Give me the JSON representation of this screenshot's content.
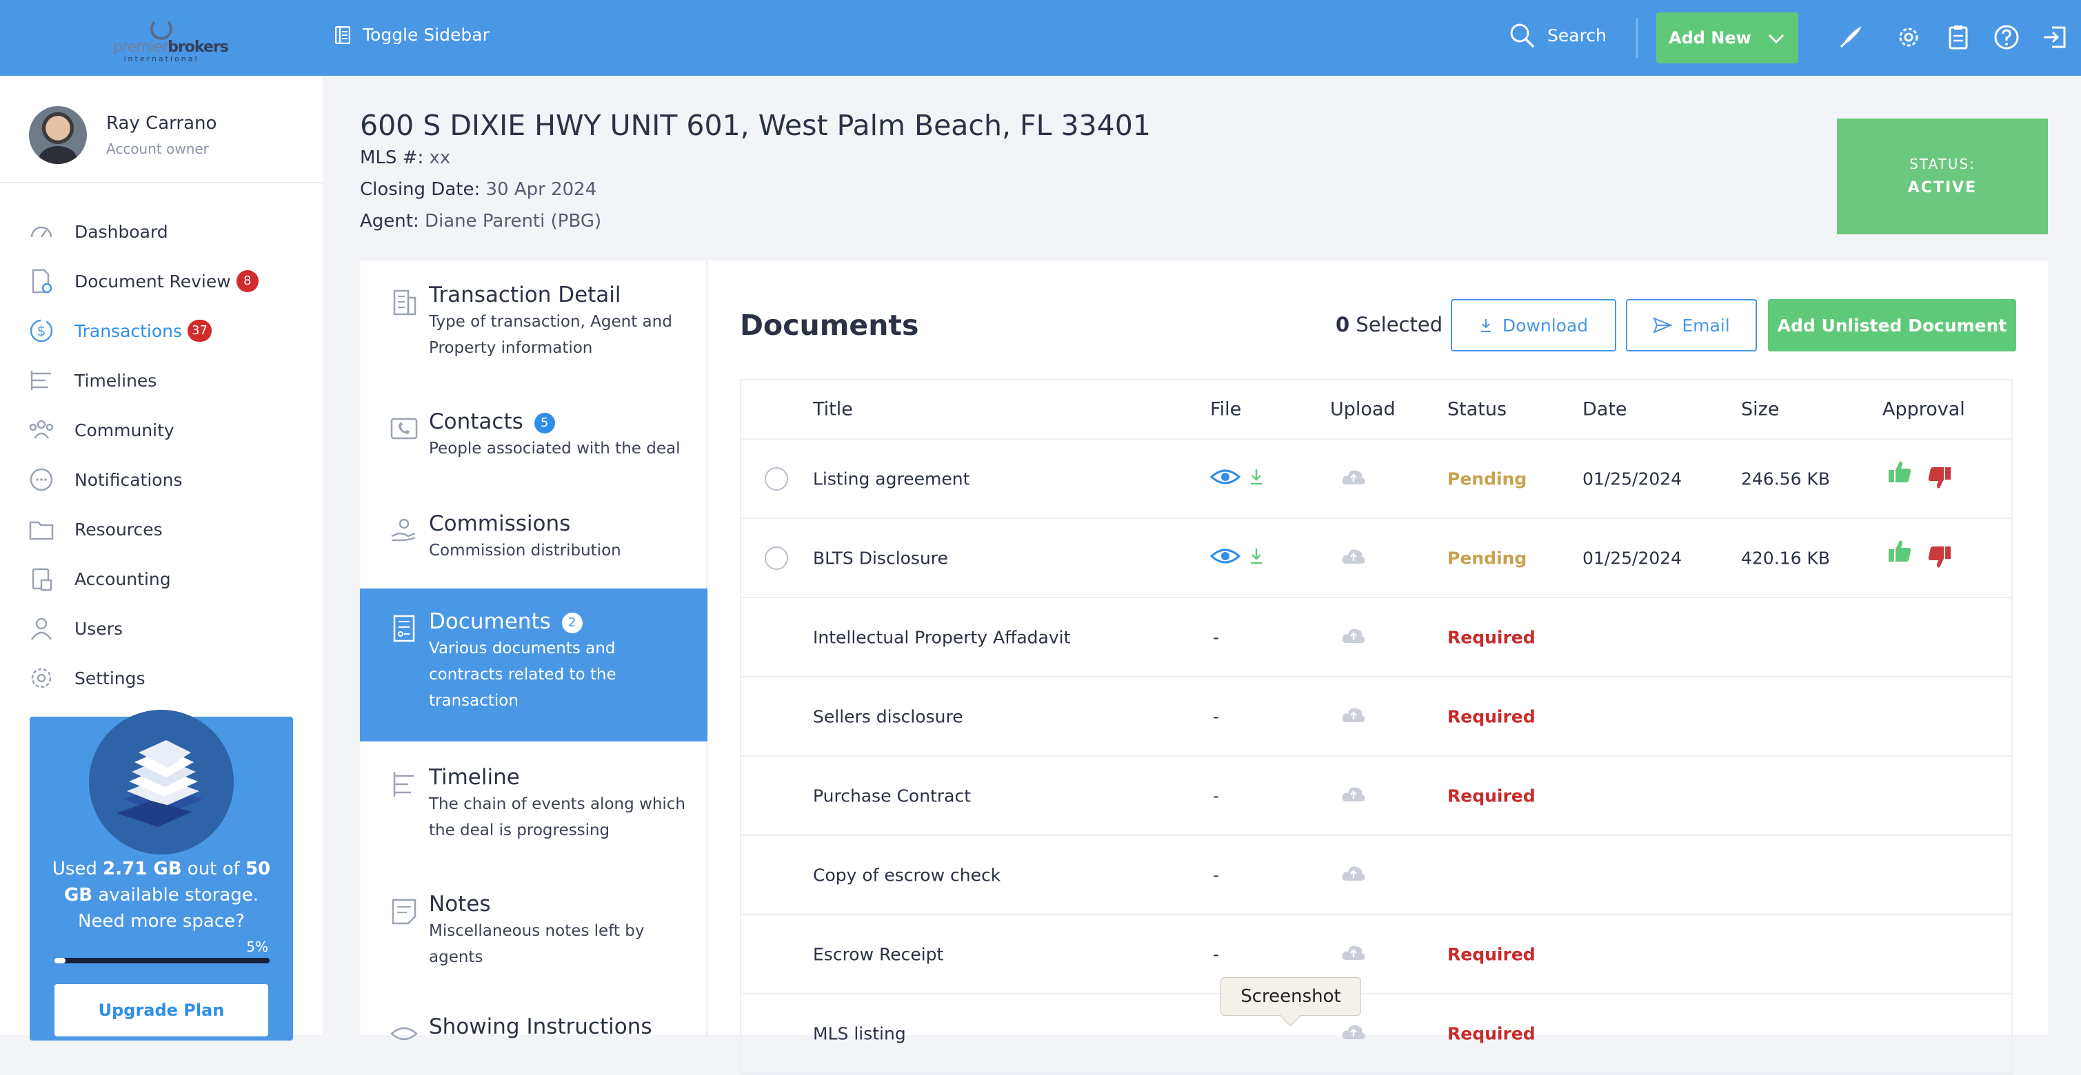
{
  "topbar": {
    "logo_word_a": "premier",
    "logo_word_b": "brokers",
    "logo_sub": "international",
    "toggle_label": "Toggle Sidebar",
    "search_label": "Search",
    "add_new_label": "Add New",
    "icons": [
      "rocket-icon",
      "gear-icon",
      "clipboard-icon",
      "help-icon",
      "logout-icon"
    ],
    "accent": "#4a97e6"
  },
  "user": {
    "name": "Ray Carrano",
    "role": "Account owner"
  },
  "sidebar": {
    "items": [
      {
        "label": "Dashboard",
        "icon": "dashboard-icon",
        "badge": ""
      },
      {
        "label": "Document Review",
        "icon": "document-review-icon",
        "badge": "8"
      },
      {
        "label": "Transactions",
        "icon": "dollar-icon",
        "badge": "37",
        "active": true
      },
      {
        "label": "Timelines",
        "icon": "timeline-icon",
        "badge": ""
      },
      {
        "label": "Community",
        "icon": "community-icon",
        "badge": ""
      },
      {
        "label": "Notifications",
        "icon": "chat-icon",
        "badge": ""
      },
      {
        "label": "Resources",
        "icon": "folder-icon",
        "badge": ""
      },
      {
        "label": "Accounting",
        "icon": "accounting-icon",
        "badge": ""
      },
      {
        "label": "Users",
        "icon": "user-icon",
        "badge": ""
      },
      {
        "label": "Settings",
        "icon": "gear-icon",
        "badge": ""
      }
    ]
  },
  "storage": {
    "prefix": "Used ",
    "used": "2.71 GB",
    "mid": " out of ",
    "total": "50 GB",
    "suffix": " available storage. Need more space?",
    "percent_label": "5%",
    "percent": 0.05,
    "upgrade_label": "Upgrade Plan"
  },
  "property": {
    "title": "600 S DIXIE HWY UNIT 601, West Palm Beach, FL 33401",
    "mls_label": "MLS #:",
    "mls_value": "xx",
    "closing_label": "Closing Date:",
    "closing_value": "30 Apr 2024",
    "agent_label": "Agent:",
    "agent_value": "Diane Parenti (PBG)",
    "status_label": "STATUS:",
    "status_value": "ACTIVE",
    "status_color": "#6cc77f"
  },
  "steps": [
    {
      "title": "Transaction Detail",
      "desc": "Type of transaction, Agent and Property information",
      "count": "",
      "icon": "building-icon"
    },
    {
      "title": "Contacts",
      "desc": "People associated with the deal",
      "count": "5",
      "icon": "phone-icon"
    },
    {
      "title": "Commissions",
      "desc": "Commission distribution",
      "count": "",
      "icon": "hand-coin-icon"
    },
    {
      "title": "Documents",
      "desc": "Various documents and contracts related to the transaction",
      "count": "2",
      "icon": "document-icon",
      "active": true
    },
    {
      "title": "Timeline",
      "desc": "The chain of events along which the deal is progressing",
      "count": "",
      "icon": "timeline-icon"
    },
    {
      "title": "Notes",
      "desc": "Miscellaneous notes left by agents",
      "count": "",
      "icon": "note-icon"
    },
    {
      "title": "Showing Instructions",
      "desc": "",
      "count": "",
      "icon": "eye-icon"
    }
  ],
  "documents": {
    "heading": "Documents",
    "selected_count": "0",
    "selected_label": "Selected",
    "download_label": "Download",
    "email_label": "Email",
    "add_unlisted_label": "Add Unlisted Document",
    "columns": [
      "Title",
      "File",
      "Upload",
      "Status",
      "Date",
      "Size",
      "Approval"
    ],
    "rows": [
      {
        "title": "Listing agreement",
        "file": "",
        "status": "Pending",
        "date": "01/25/2024",
        "size": "246.56 KB",
        "has_file": true
      },
      {
        "title": "BLTS Disclosure",
        "file": "",
        "status": "Pending",
        "date": "01/25/2024",
        "size": "420.16 KB",
        "has_file": true
      },
      {
        "title": "Intellectual Property Affadavit",
        "file": "-",
        "status": "Required",
        "date": "",
        "size": "",
        "has_file": false
      },
      {
        "title": "Sellers disclosure",
        "file": "-",
        "status": "Required",
        "date": "",
        "size": "",
        "has_file": false
      },
      {
        "title": "Purchase Contract",
        "file": "-",
        "status": "Required",
        "date": "",
        "size": "",
        "has_file": false
      },
      {
        "title": "Copy of escrow check",
        "file": "-",
        "status": "",
        "date": "",
        "size": "",
        "has_file": false
      },
      {
        "title": "Escrow Receipt",
        "file": "-",
        "status": "Required",
        "date": "",
        "size": "",
        "has_file": false
      },
      {
        "title": "MLS listing",
        "file": "",
        "status": "Required",
        "date": "",
        "size": "",
        "has_file": false
      }
    ]
  },
  "tooltip": {
    "text": "Screenshot"
  }
}
